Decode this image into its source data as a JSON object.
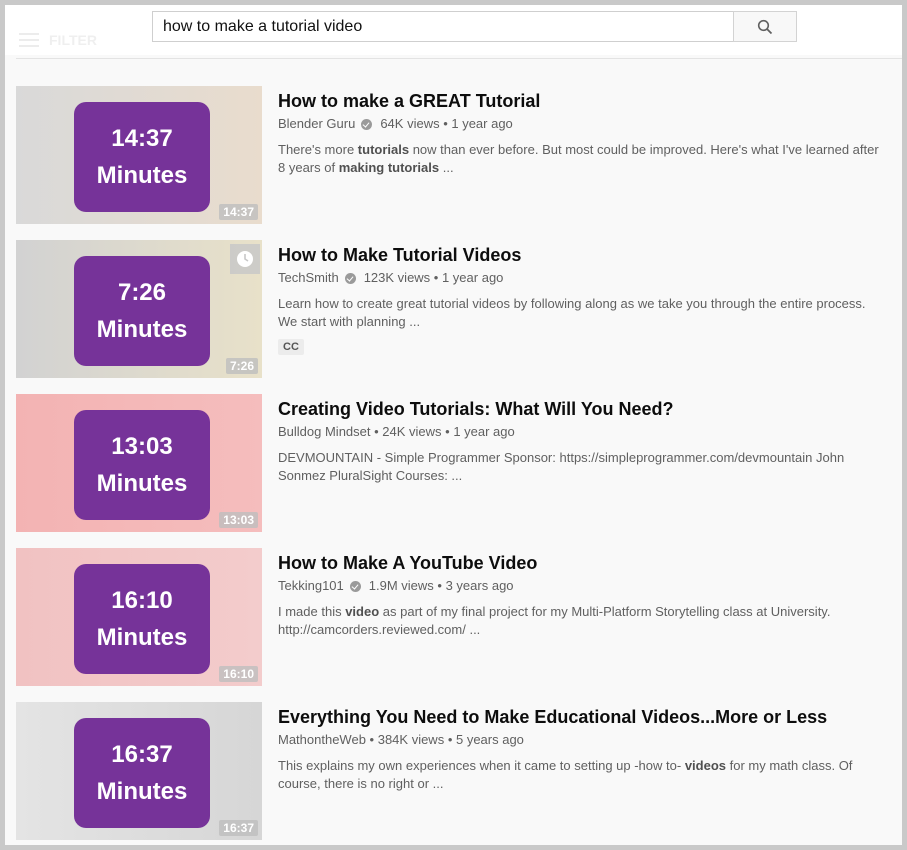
{
  "header": {
    "filter_label": "FILTER",
    "search": {
      "value": "how to make a tutorial video",
      "placeholder": "Search"
    },
    "search_button_icon": "search-icon"
  },
  "badge_suffix": "Minutes",
  "results": [
    {
      "title": "How to make a GREAT Tutorial",
      "channel": "Blender Guru",
      "verified": true,
      "views": "64K views",
      "age": "1 year ago",
      "desc_parts": [
        "There's more ",
        "tutorials",
        " now than ever before. But most could be improved. Here's what I've learned after 8 years of ",
        "making tutorials",
        " ..."
      ],
      "duration": "14:37",
      "badge_time": "14:37",
      "thumb_colors": [
        "#d9d9d9",
        "#e9dccd"
      ]
    },
    {
      "title": "How to Make Tutorial Videos",
      "channel": "TechSmith",
      "verified": true,
      "views": "123K views",
      "age": "1 year ago",
      "desc_parts": [
        "Learn how to create great tutorial videos by following along as we take you through the entire process. We start with planning ..."
      ],
      "cc": "CC",
      "duration": "7:26",
      "badge_time": "7:26",
      "thumb_colors": [
        "#d2d2d2",
        "#e8e1c9"
      ]
    },
    {
      "title": "Creating Video Tutorials: What Will You Need?",
      "channel": "Bulldog Mindset",
      "verified": false,
      "views": "24K views",
      "age": "1 year ago",
      "desc_parts": [
        "DEVMOUNTAIN - Simple Programmer Sponsor: https://simpleprogrammer.com/devmountain John Sonmez PluralSight Courses: ..."
      ],
      "duration": "13:03",
      "badge_time": "13:03",
      "thumb_colors": [
        "#f3b3b3",
        "#f5bdbd"
      ]
    },
    {
      "title": "How to Make A YouTube Video",
      "channel": "Tekking101",
      "verified": true,
      "views": "1.9M views",
      "age": "3 years ago",
      "desc_parts": [
        "I made this ",
        "video",
        " as part of my final project for my Multi-Platform Storytelling class at University. http://camcorders.reviewed.com/ ..."
      ],
      "duration": "16:10",
      "badge_time": "16:10",
      "thumb_colors": [
        "#f1c2c2",
        "#f3cccc"
      ]
    },
    {
      "title": "Everything You Need to Make Educational Videos...More or Less",
      "channel": "MathontheWeb",
      "verified": false,
      "views": "384K views",
      "age": "5 years ago",
      "desc_parts": [
        "This explains my own experiences when it came to setting up -how to- ",
        "videos",
        " for my math class. Of course, there is no right or ..."
      ],
      "duration": "16:37",
      "badge_time": "16:37",
      "thumb_colors": [
        "#e4e4e4",
        "#d6d6d6"
      ]
    }
  ]
}
